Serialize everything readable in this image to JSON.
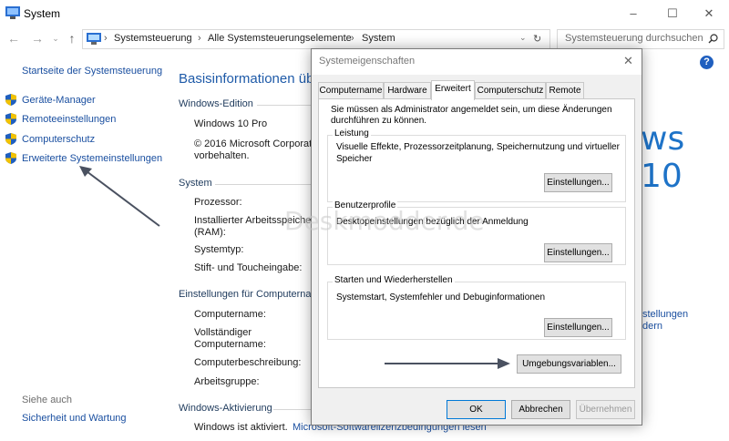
{
  "window": {
    "title": "System",
    "minimize": "–",
    "maximize": "☐",
    "close": "✕"
  },
  "address": {
    "crumbs": [
      "Systemsteuerung",
      "Alle Systemsteuerungselemente",
      "System"
    ],
    "separator": "›",
    "search_placeholder": "Systemsteuerung durchsuchen"
  },
  "sidebar": {
    "home": "Startseite der Systemsteuerung",
    "items": [
      {
        "label": "Geräte-Manager"
      },
      {
        "label": "Remoteeinstellungen"
      },
      {
        "label": "Computerschutz"
      },
      {
        "label": "Erweiterte Systemeinstellungen"
      }
    ],
    "see_also": "Siehe auch",
    "see_also_link": "Sicherheit und Wartung"
  },
  "main": {
    "heading": "Basisinformationen übe",
    "edition_section": "Windows-Edition",
    "edition": "Windows 10 Pro",
    "copyright_line1": "© 2016 Microsoft Corporati",
    "copyright_line2": "vorbehalten.",
    "brand": "ws 10",
    "system_section": "System",
    "processor": "Prozessor:",
    "ram_line1": "Installierter Arbeitsspeicher",
    "ram_line2": "(RAM):",
    "systemtype": "Systemtyp:",
    "pen": "Stift- und Toucheingabe:",
    "computer_section": "Einstellungen für Computernan",
    "computer_name": "Computername:",
    "full_name_line1": "Vollständiger",
    "full_name_line2": "Computername:",
    "description": "Computerbeschreibung:",
    "workgroup": "Arbeitsgruppe:",
    "change_link_line1": "stellungen",
    "change_link_line2": "dern",
    "activation_section": "Windows-Aktivierung",
    "activated": "Windows ist aktiviert.",
    "license_link": "Microsoft-Softwarelizenzbedingungen lesen"
  },
  "help": "?",
  "dialog": {
    "title": "Systemeigenschaften",
    "close": "✕",
    "tabs": [
      "Computername",
      "Hardware",
      "Erweitert",
      "Computerschutz",
      "Remote"
    ],
    "active_tab": "Erweitert",
    "admin_note_line1": "Sie müssen als Administrator angemeldet sein, um diese Änderungen",
    "admin_note_line2": "durchführen zu können.",
    "performance": {
      "label": "Leistung",
      "text_line1": "Visuelle Effekte, Prozessorzeitplanung, Speichernutzung und virtueller",
      "text_line2": "Speicher",
      "button": "Einstellungen..."
    },
    "profiles": {
      "label": "Benutzerprofile",
      "text": "Desktopeinstellungen bezüglich der Anmeldung",
      "button": "Einstellungen..."
    },
    "startup": {
      "label": "Starten und Wiederherstellen",
      "text": "Systemstart, Systemfehler und Debuginformationen",
      "button": "Einstellungen..."
    },
    "env_button": "Umgebungsvariablen...",
    "ok": "OK",
    "cancel": "Abbrechen",
    "apply": "Übernehmen"
  },
  "watermark": "Deskmodder.de",
  "colors": {
    "link": "#1a4fa0",
    "heading": "#1e5aa8",
    "shield_blue": "#1f5fbf",
    "shield_yellow": "#f2c200"
  }
}
